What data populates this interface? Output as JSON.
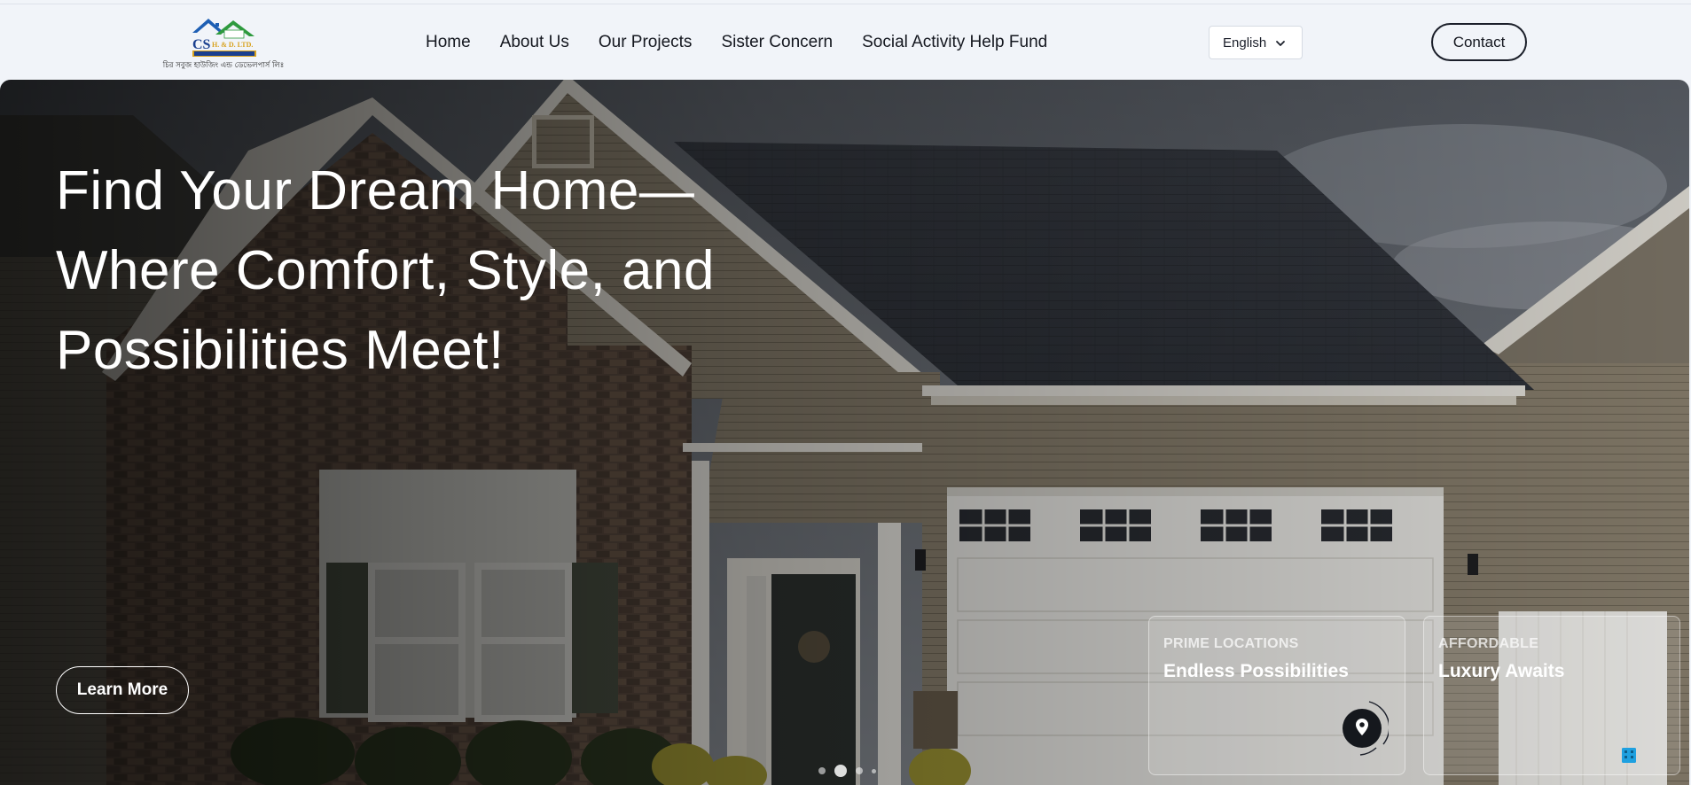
{
  "brand": {
    "logo_text_main": "CS",
    "logo_text_sub": "H. & D. LTD.",
    "logo_ribbon": "মানবিক মানেয়াম মব পূনা",
    "tagline": "চির সবুজ হাউজিং এন্ড ডেভেলপার্স লিঃ",
    "colors": {
      "roof_blue": "#1e5fb4",
      "roof_green": "#2e9a3e",
      "gold": "#d8a21e",
      "navy": "#1a3f8f"
    }
  },
  "nav": {
    "items": [
      {
        "label": "Home"
      },
      {
        "label": "About Us"
      },
      {
        "label": "Our Projects"
      },
      {
        "label": "Sister Concern"
      },
      {
        "label": "Social Activity Help Fund"
      }
    ]
  },
  "language": {
    "selected": "English",
    "icon": "chevron-down-icon"
  },
  "contact": {
    "label": "Contact"
  },
  "hero": {
    "title_lines": [
      "Find Your Dream Home—",
      "Where Comfort, Style, and",
      "Possibilities Meet!"
    ],
    "cta_label": "Learn More",
    "cards": [
      {
        "eyebrow": "PRIME LOCATIONS",
        "title": "Endless Possibilities",
        "icon": "location-pin-icon"
      },
      {
        "eyebrow": "AFFORDABLE",
        "title": "Luxury Awaits",
        "icon": "building-icon"
      }
    ],
    "carousel": {
      "slides": 4,
      "active_index": 1
    }
  },
  "colors": {
    "page_bg": "#f1f4f9",
    "text": "#14171f",
    "hero_text": "#ffffff",
    "accent_blue": "#1ea0e0"
  }
}
